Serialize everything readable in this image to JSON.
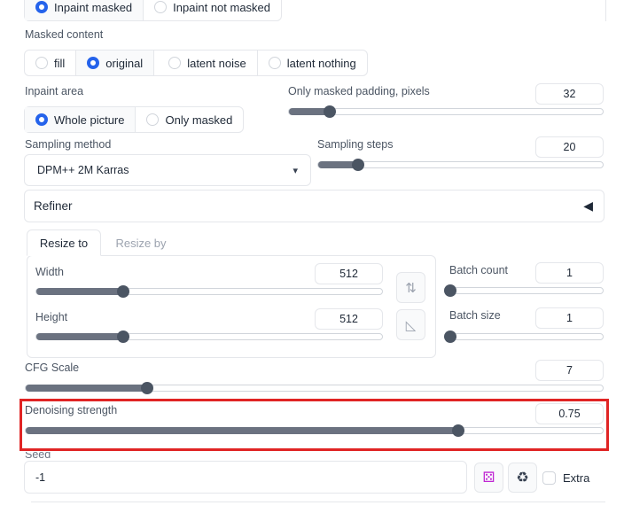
{
  "mask_mode": {
    "options": [
      "Inpaint masked",
      "Inpaint not masked"
    ],
    "selected": 0
  },
  "masked_content": {
    "label": "Masked content",
    "options": [
      "fill",
      "original",
      "latent noise",
      "latent nothing"
    ],
    "selected": 1
  },
  "inpaint_area": {
    "label": "Inpaint area",
    "options": [
      "Whole picture",
      "Only masked"
    ],
    "selected": 0
  },
  "padding": {
    "label": "Only masked padding, pixels",
    "value": "32",
    "fraction": 0.13
  },
  "sampling_method": {
    "label": "Sampling method",
    "value": "DPM++ 2M Karras",
    "chevron": "▾"
  },
  "sampling_steps": {
    "label": "Sampling steps",
    "value": "20",
    "fraction": 0.14
  },
  "refiner": {
    "label": "Refiner",
    "icon": "◀"
  },
  "tabs": {
    "items": [
      "Resize to",
      "Resize by"
    ],
    "active": 0
  },
  "width": {
    "label": "Width",
    "value": "512",
    "fraction": 0.25
  },
  "height": {
    "label": "Height",
    "value": "512",
    "fraction": 0.25
  },
  "swap_icon": "⇅",
  "ratio_icon": "◺",
  "batch_count": {
    "label": "Batch count",
    "value": "1",
    "fraction": 0.0
  },
  "batch_size": {
    "label": "Batch size",
    "value": "1",
    "fraction": 0.0
  },
  "cfg_scale": {
    "label": "CFG Scale",
    "value": "7",
    "fraction": 0.21
  },
  "denoising": {
    "label": "Denoising strength",
    "value": "0.75",
    "fraction": 0.75,
    "highlight_color": "#e02424"
  },
  "seed": {
    "label": "Seed",
    "value": "-1",
    "dice_icon": "⚄",
    "recycle_icon": "♻",
    "extra_label": "Extra"
  },
  "colors": {
    "accent": "#2563eb",
    "slider": "#6b7280",
    "highlight": "#e02424"
  }
}
